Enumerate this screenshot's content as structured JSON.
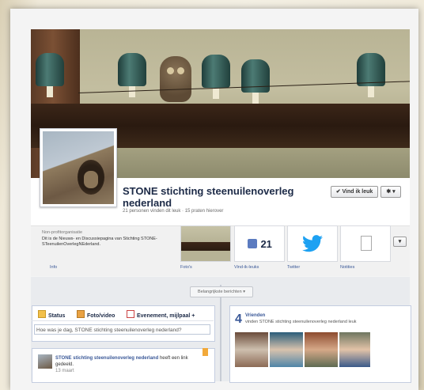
{
  "page": {
    "name": "STONE stichting steenuilenoverleg nederland",
    "likes_line": "21 personen vinden dit leuk · 15 praten hierover",
    "like_button": "✔ Vind ik leuk",
    "settings_button": "✱ ▾"
  },
  "about": {
    "category": "Non-profitorganisatie",
    "description": "Dit is de Nieuws- en Discussiepagina van Stichting STONE-STeenuilenOverlegNEderland.",
    "label": "Info"
  },
  "tiles": [
    {
      "label": "Foto's"
    },
    {
      "label": "Vind-ik-leuks",
      "count": "21"
    },
    {
      "label": "Twitter"
    },
    {
      "label": "Notities"
    }
  ],
  "timeline": {
    "sort_button": "Belangrijkste berichten ▾"
  },
  "composer": {
    "tab_status": "Status",
    "tab_photo": "Foto/video",
    "tab_event": "Evenement, mijlpaal +",
    "placeholder": "Hoe was je dag, STONE      stichting steenuilenoverleg nederland?"
  },
  "post": {
    "author": "STONE stichting steenuilenoverleg nederland",
    "action": "heeft een link gedeeld.",
    "date": "13 maart"
  },
  "friends": {
    "count": "4",
    "heading": "Vrienden",
    "subtitle": "vinden STONE stichting steenuilenoverleg nederland leuk"
  },
  "colors": {
    "brand": "#3b5998",
    "twitter": "#1da1f2"
  }
}
